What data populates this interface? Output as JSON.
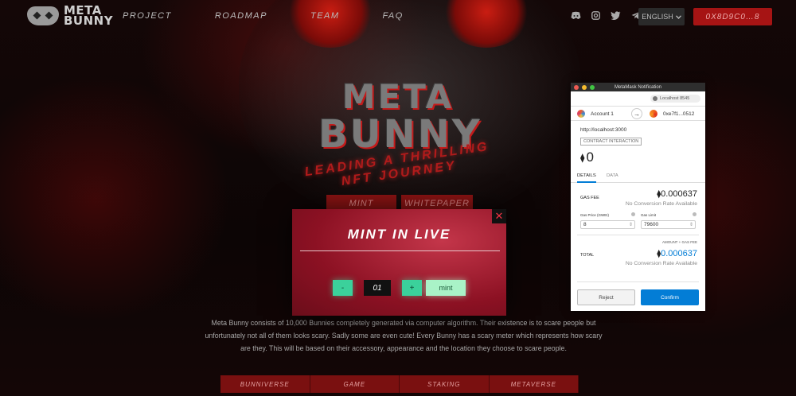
{
  "nav": {
    "logo_line1": "META",
    "logo_line2": "BUNNY",
    "links": [
      "PROJECT",
      "ROADMAP",
      "TEAM",
      "FAQ"
    ],
    "socials": [
      "discord-icon",
      "instagram-icon",
      "twitter-icon",
      "telegram-icon"
    ],
    "language": "ENGLISH",
    "wallet_address": "0X8D9C0…8"
  },
  "hero": {
    "title_line1": "META",
    "title_line2": "BUNNY",
    "tagline_line1": "LEADING A THRILLING",
    "tagline_line2": "NFT JOURNEY",
    "mint_button": "MINT",
    "whitepaper_button": "WHITEPAPER"
  },
  "description": "Meta Bunny consists of 10,000 Bunnies completely generated via computer algorithm. Their existence is to scare people but unfortunately not all of them looks scary. Sadly some are even cute! Every Bunny has a scary meter which represents how scary are they. This will be based on their accessory, appearance and the location they choose to scare people.",
  "bottom_tabs": [
    "BUNNIVERSE",
    "GAME",
    "STAKING",
    "METAVERSE"
  ],
  "mint_modal": {
    "close": "✕",
    "title": "MINT IN LIVE",
    "minus": "-",
    "quantity": "01",
    "plus": "+",
    "mint_button": "mint"
  },
  "metamask": {
    "window_title": "MetaMask Notification",
    "network": "Localhost 8545",
    "account_from": "Account 1",
    "account_to": "0xe7f1...0512",
    "origin": "http://localhost:3000",
    "badge": "CONTRACT INTERACTION",
    "amount": "0",
    "tab_details": "DETAILS",
    "tab_data": "DATA",
    "gas_fee_label": "GAS FEE",
    "gas_fee_value": "0.000637",
    "no_conversion": "No Conversion Rate Available",
    "gas_price_label": "Gas Price (GWEI)",
    "gas_price_value": "8",
    "gas_limit_label": "Gas Limit",
    "gas_limit_value": "79600",
    "amount_plus_gas_label": "AMOUNT + GAS FEE",
    "total_label": "TOTAL",
    "total_value": "0.000637",
    "total_no_conversion": "No Conversion Rate Available",
    "reject": "Reject",
    "confirm": "Confirm"
  }
}
